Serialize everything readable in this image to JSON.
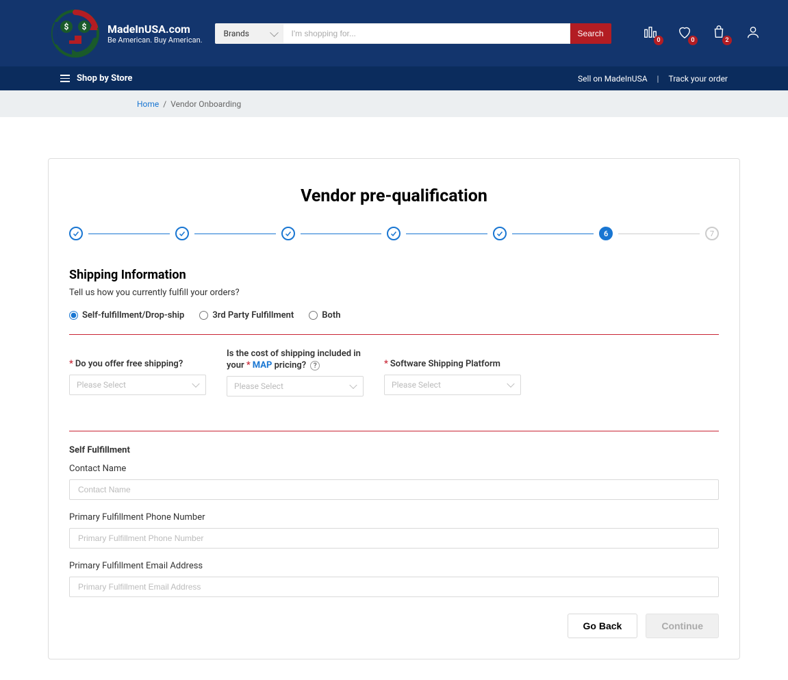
{
  "header": {
    "site_name": "MadeInUSA.com",
    "tagline": "Be American. Buy American.",
    "brand_selector": "Brands",
    "search_placeholder": "I'm shopping for...",
    "search_button": "Search",
    "badges": {
      "compare": "0",
      "wishlist": "0",
      "cart": "2"
    }
  },
  "nav": {
    "shop_by_store": "Shop by Store",
    "sell_link": "Sell on MadeInUSA",
    "track_link": "Track your order"
  },
  "breadcrumb": {
    "home": "Home",
    "current": "Vendor Onboarding"
  },
  "page": {
    "title": "Vendor pre-qualification",
    "current_step": "6",
    "pending_step": "7",
    "section_title": "Shipping Information",
    "section_subtitle": "Tell us how you currently fulfill your orders?",
    "fulfillment_options": {
      "self": "Self-fulfillment/Drop-ship",
      "third": "3rd Party Fulfillment",
      "both": "Both"
    },
    "q1": {
      "label": "Do you offer free shipping?",
      "placeholder": "Please Select"
    },
    "q2": {
      "prefix": "Is the cost of shipping included in your",
      "map": "MAP",
      "suffix": "pricing?",
      "placeholder": "Please Select"
    },
    "q3": {
      "label": "Software Shipping Platform",
      "placeholder": "Please Select"
    },
    "self_section": {
      "title": "Self Fulfillment",
      "contact_label": "Contact Name",
      "contact_placeholder": "Contact Name",
      "phone_label": "Primary Fulfillment Phone Number",
      "phone_placeholder": "Primary Fulfillment Phone Number",
      "email_label": "Primary Fulfillment Email Address",
      "email_placeholder": "Primary Fulfillment Email Address"
    },
    "buttons": {
      "goback": "Go Back",
      "continue": "Continue"
    }
  }
}
